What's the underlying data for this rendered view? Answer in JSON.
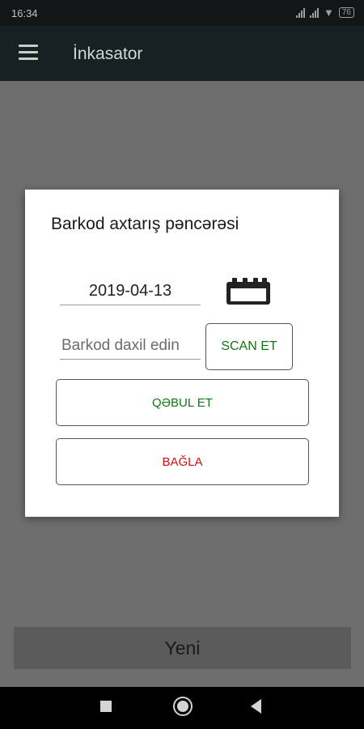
{
  "status_bar": {
    "time": "16:34",
    "battery": "76",
    "icons": [
      "signal-icon",
      "signal-icon",
      "wifi-icon",
      "battery-icon"
    ]
  },
  "app_bar": {
    "title": "İnkasator",
    "menu_icon": "hamburger-menu-icon"
  },
  "dialog": {
    "title": "Barkod axtarış pəncərəsi",
    "date_value": "2019-04-13",
    "calendar_icon": "calendar-icon",
    "barcode_placeholder": "Barkod daxil edin",
    "barcode_value": "",
    "scan_label": "SCAN ET",
    "accept_label": "QƏBUL ET",
    "close_label": "BAĞLA"
  },
  "main": {
    "new_label": "Yeni"
  },
  "nav_bar": {
    "icons": [
      "recents-square-icon",
      "home-circle-icon",
      "back-triangle-icon"
    ]
  },
  "colors": {
    "app_bar": "#172121",
    "overlay": "#6e6e6e",
    "accept_text": "#117711",
    "close_text": "#cc1111"
  }
}
